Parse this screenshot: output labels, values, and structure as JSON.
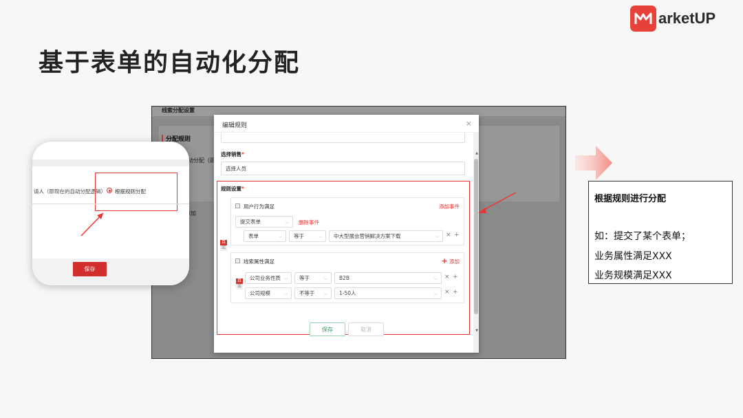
{
  "logo": {
    "mark": "M",
    "text": "arketUP"
  },
  "slide_title": "基于表单的自动化分配",
  "background_app": {
    "page_title": "线索分配设置",
    "rule_title": "分配规则",
    "faded_text": "动分配（即",
    "faded_text2": "添加"
  },
  "inset": {
    "faded_option": "请人（即现在的自动分配逻辑）",
    "radio_label": "根据规则分配",
    "save_label": "保存"
  },
  "modal": {
    "title": "编辑规则",
    "close": "×",
    "sales_label": "选择销售",
    "sales_placeholder": "选择人员",
    "rules_label": "规则设置",
    "required_mark": "*",
    "group1": {
      "title": "用户行为满足",
      "add_event": "添加事件",
      "event_select": "提交表单",
      "delete_event": "删除事件",
      "and_tag": [
        "且",
        "或"
      ],
      "condition": {
        "field": "表单",
        "op": "等于",
        "value": "中大型展会营销解决方案下载"
      }
    },
    "group2": {
      "title": "线索属性满足",
      "add_label": "添加",
      "and_tag": [
        "且",
        "或"
      ],
      "conditions": [
        {
          "field": "公司业务性质",
          "op": "等于",
          "value": "B2B"
        },
        {
          "field": "公司规模",
          "op": "不等于",
          "value": "1-50人"
        }
      ]
    },
    "outer_and_tag": [
      "且",
      "或"
    ],
    "save_label": "保存",
    "cancel_label": "取消"
  },
  "description": {
    "title": "根据规则进行分配",
    "lines": [
      "如：提交了某个表单；",
      "业务属性满足XXX",
      "业务规模满足XXX"
    ]
  },
  "colors": {
    "accent_red": "#e33333",
    "logo_red": "#e8413a",
    "save_green": "#2b9a58"
  }
}
